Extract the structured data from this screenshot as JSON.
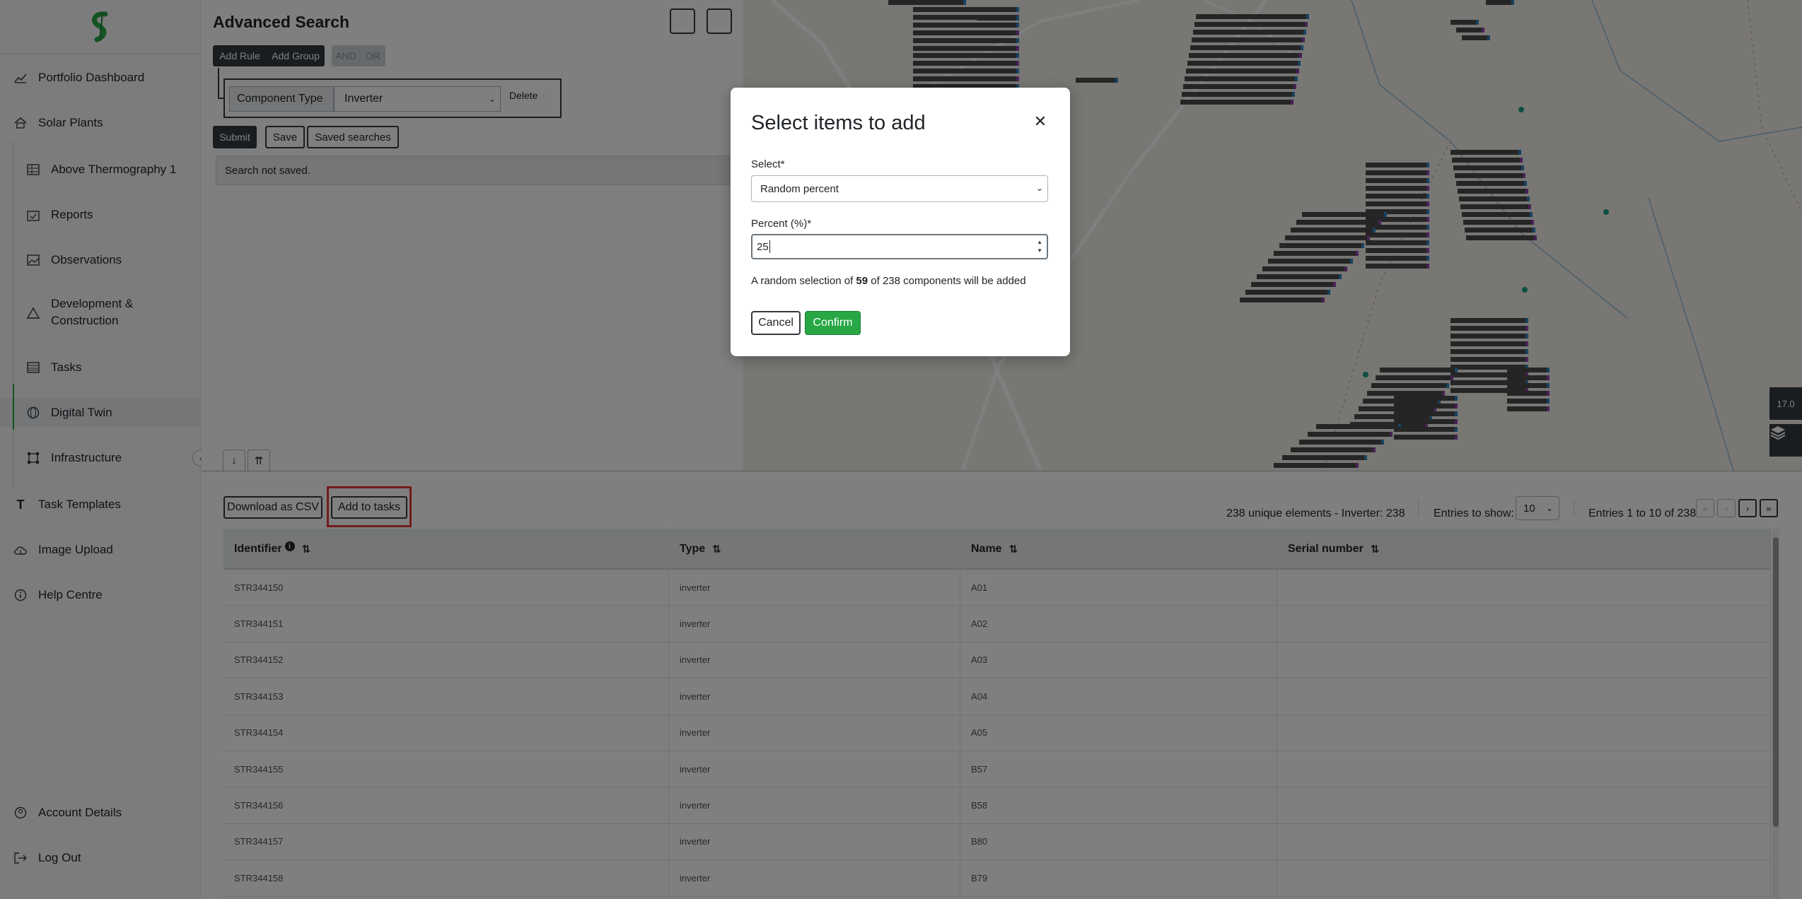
{
  "sidebar": {
    "logo_icon": "dollar-s-logo-icon",
    "brand_color": "#28a745",
    "items": [
      {
        "label": "Portfolio Dashboard",
        "icon": "line-chart-icon"
      },
      {
        "label": "Solar Plants",
        "icon": "home-icon"
      },
      {
        "label": "Above Thermography 1",
        "icon": "grid-icon"
      },
      {
        "label": "Reports",
        "icon": "calendar-check-icon"
      },
      {
        "label": "Observations",
        "icon": "image-icon"
      },
      {
        "label": "Development &",
        "label2": "Construction",
        "icon": "warning-triangle-icon"
      },
      {
        "label": "Tasks",
        "icon": "list-table-icon"
      },
      {
        "label": "Digital Twin",
        "icon": "globe-icon"
      },
      {
        "label": "Infrastructure",
        "icon": "vector-square-icon"
      },
      {
        "label": "Task Templates",
        "icon": "text-t-icon"
      },
      {
        "label": "Image Upload",
        "icon": "cloud-upload-icon"
      },
      {
        "label": "Help Centre",
        "icon": "info-circle-icon"
      }
    ],
    "footer": [
      {
        "label": "Account Details",
        "icon": "user-circle-icon"
      },
      {
        "label": "Log Out",
        "icon": "logout-icon"
      }
    ]
  },
  "search": {
    "title": "Advanced Search",
    "add_rule": "Add Rule",
    "add_group": "Add Group",
    "and": "AND",
    "or": "OR",
    "rule_field": "Component Type",
    "rule_value": "Inverter",
    "delete": "Delete",
    "submit": "Submit",
    "save": "Save",
    "saved_searches": "Saved searches",
    "status": "Search not saved."
  },
  "map": {
    "zoom": "17.0",
    "layers_icon": "layers-icon"
  },
  "tabs": {
    "down": "↓",
    "up": "⇈"
  },
  "results": {
    "download_csv": "Download as CSV",
    "add_to_tasks": "Add to tasks",
    "summary": "238 unique elements - Inverter: 238",
    "entries_label": "Entries to show:",
    "entries_value": "10",
    "range": "Entries 1 to 10 of 238",
    "pager": [
      "«",
      "‹",
      "›",
      "»"
    ]
  },
  "table": {
    "columns": [
      "Identifier",
      "Type",
      "Name",
      "Serial number"
    ],
    "rows": [
      [
        "STR344150",
        "inverter",
        "A01",
        ""
      ],
      [
        "STR344151",
        "inverter",
        "A02",
        ""
      ],
      [
        "STR344152",
        "inverter",
        "A03",
        ""
      ],
      [
        "STR344153",
        "inverter",
        "A04",
        ""
      ],
      [
        "STR344154",
        "inverter",
        "A05",
        ""
      ],
      [
        "STR344155",
        "inverter",
        "B57",
        ""
      ],
      [
        "STR344156",
        "inverter",
        "B58",
        ""
      ],
      [
        "STR344157",
        "inverter",
        "B80",
        ""
      ],
      [
        "STR344158",
        "inverter",
        "B79",
        ""
      ]
    ]
  },
  "modal": {
    "title": "Select items to add",
    "select_label": "Select*",
    "select_value": "Random percent",
    "percent_label": "Percent (%)*",
    "percent_value": "25",
    "note_prefix": "A random selection of ",
    "note_count": "59",
    "note_suffix": " of 238 components will be added",
    "cancel": "Cancel",
    "confirm": "Confirm"
  }
}
